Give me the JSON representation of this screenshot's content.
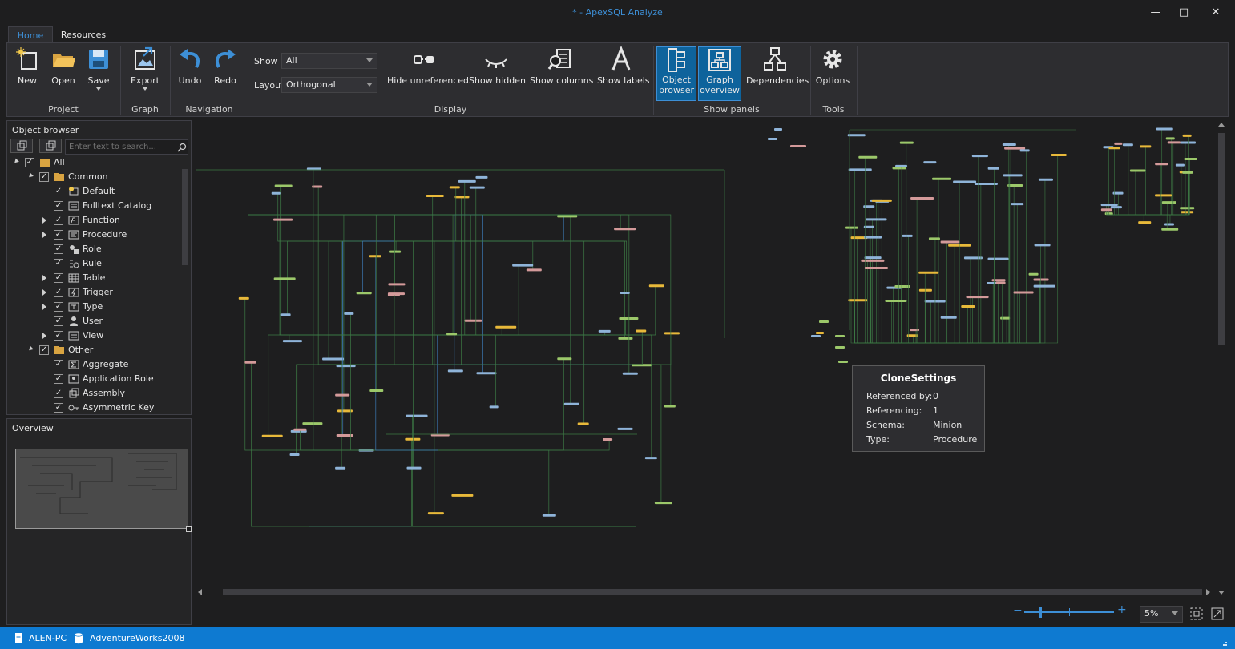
{
  "window": {
    "title": "* - ApexSQL Analyze"
  },
  "tabs": [
    {
      "label": "Home",
      "active": true
    },
    {
      "label": "Resources",
      "active": false
    }
  ],
  "ribbon": {
    "new": "New",
    "open": "Open",
    "save": "Save",
    "export": "Export",
    "undo": "Undo",
    "redo": "Redo",
    "show_label": "Show",
    "show_value": "All",
    "layout_label": "Layout",
    "layout_value": "Orthogonal",
    "hide_unreferenced": "Hide unreferenced",
    "show_hidden": "Show hidden",
    "show_columns": "Show columns",
    "show_labels": "Show labels",
    "object_browser_1": "Object",
    "object_browser_2": "browser",
    "graph_overview_1": "Graph",
    "graph_overview_2": "overview",
    "dependencies": "Dependencies",
    "options": "Options",
    "groups": {
      "project": "Project",
      "graph": "Graph",
      "navigation": "Navigation",
      "display": "Display",
      "show_panels": "Show panels",
      "tools": "Tools"
    }
  },
  "object_browser": {
    "title": "Object browser",
    "search_placeholder": "Enter text to search...",
    "tree": [
      {
        "label": "All",
        "level": 0,
        "expander": "open",
        "icon": "folder-icon"
      },
      {
        "label": "Common",
        "level": 1,
        "expander": "open",
        "icon": "folder-icon"
      },
      {
        "label": "Default",
        "level": 2,
        "expander": "",
        "icon": "default-icon"
      },
      {
        "label": "Fulltext Catalog",
        "level": 2,
        "expander": "",
        "icon": "fulltext-icon"
      },
      {
        "label": "Function",
        "level": 2,
        "expander": "closed",
        "icon": "function-icon"
      },
      {
        "label": "Procedure",
        "level": 2,
        "expander": "closed",
        "icon": "procedure-icon"
      },
      {
        "label": "Role",
        "level": 2,
        "expander": "",
        "icon": "role-icon"
      },
      {
        "label": "Rule",
        "level": 2,
        "expander": "",
        "icon": "rule-icon"
      },
      {
        "label": "Table",
        "level": 2,
        "expander": "closed",
        "icon": "table-icon"
      },
      {
        "label": "Trigger",
        "level": 2,
        "expander": "closed",
        "icon": "trigger-icon"
      },
      {
        "label": "Type",
        "level": 2,
        "expander": "closed",
        "icon": "type-icon"
      },
      {
        "label": "User",
        "level": 2,
        "expander": "",
        "icon": "user-icon"
      },
      {
        "label": "View",
        "level": 2,
        "expander": "closed",
        "icon": "view-icon"
      },
      {
        "label": "Other",
        "level": 1,
        "expander": "open",
        "icon": "folder-icon"
      },
      {
        "label": "Aggregate",
        "level": 2,
        "expander": "",
        "icon": "aggregate-icon"
      },
      {
        "label": "Application Role",
        "level": 2,
        "expander": "",
        "icon": "application-role-icon"
      },
      {
        "label": "Assembly",
        "level": 2,
        "expander": "",
        "icon": "assembly-icon"
      },
      {
        "label": "Asymmetric Key",
        "level": 2,
        "expander": "",
        "icon": "asymmetric-key-icon"
      }
    ]
  },
  "overview": {
    "title": "Overview"
  },
  "tooltip": {
    "title": "CloneSettings",
    "rows": [
      {
        "key": "Referenced by:",
        "value": "0"
      },
      {
        "key": "Referencing:",
        "value": "1"
      },
      {
        "key": "Schema:",
        "value": "Minion"
      },
      {
        "key": "Type:",
        "value": "Procedure"
      }
    ]
  },
  "zoom": {
    "value": "5%",
    "level": 0.05
  },
  "status": {
    "server": "ALEN-PC",
    "database": "AdventureWorks2008"
  },
  "colors": {
    "accent": "#0e7ad1",
    "edge": "#3d7a45",
    "node_blue": "#8fb4d9",
    "node_yellow": "#e8b93a",
    "node_green": "#9cc86a",
    "node_red": "#d49a9a"
  }
}
